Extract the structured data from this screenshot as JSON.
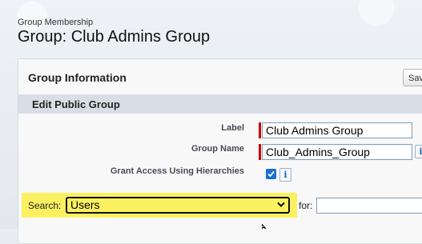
{
  "header": {
    "subtitle": "Group Membership",
    "title": "Group: Club Admins Group"
  },
  "panel": {
    "title": "Group Information",
    "save_label": "Save",
    "section_title": "Edit Public Group"
  },
  "form": {
    "label_field": {
      "label": "Label",
      "value": "Club Admins Group"
    },
    "group_name_field": {
      "label": "Group Name",
      "value": "Club_Admins_Group"
    },
    "grant_access": {
      "label": "Grant Access Using Hierarchies",
      "checked": true
    },
    "info_glyph": "i"
  },
  "search": {
    "label": "Search:",
    "selected": "Users",
    "for_label": "for:",
    "for_value": ""
  },
  "colors": {
    "required_marker": "#cc0000",
    "highlight": "#fbf160",
    "checkbox": "#1a6fd1"
  }
}
